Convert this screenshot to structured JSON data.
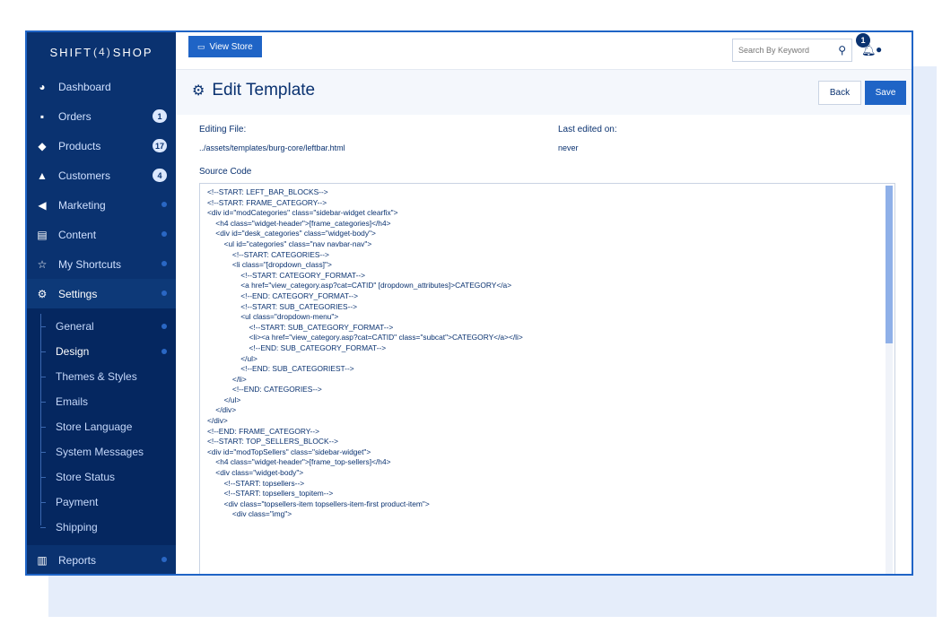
{
  "brand": {
    "left": "SHIFT",
    "mid": "4",
    "right": "SHOP"
  },
  "sidebar": {
    "items": [
      {
        "label": "Dashboard",
        "icon": "dashboard-icon",
        "glyph": "◕"
      },
      {
        "label": "Orders",
        "icon": "cart-icon",
        "glyph": "🛒",
        "badge": "1"
      },
      {
        "label": "Products",
        "icon": "tag-icon",
        "glyph": "◆",
        "badge": "17"
      },
      {
        "label": "Customers",
        "icon": "user-icon",
        "glyph": "▲",
        "badge": "4"
      },
      {
        "label": "Marketing",
        "icon": "megaphone-icon",
        "glyph": "◀"
      },
      {
        "label": "Content",
        "icon": "document-icon",
        "glyph": "▤"
      },
      {
        "label": "My Shortcuts",
        "icon": "star-icon",
        "glyph": "☆"
      },
      {
        "label": "Settings",
        "icon": "gears-icon",
        "glyph": "⚙"
      }
    ],
    "settings_sub": [
      "General",
      "Design",
      "Themes & Styles",
      "Emails",
      "Store Language",
      "System Messages",
      "Store Status",
      "Payment",
      "Shipping"
    ],
    "reports": {
      "label": "Reports",
      "icon": "bar-chart-icon",
      "glyph": "▥"
    }
  },
  "topbar": {
    "view_store": "View Store",
    "search_placeholder": "Search By Keyword",
    "notification_count": "1"
  },
  "page": {
    "title": "Edit Template",
    "back": "Back",
    "save": "Save",
    "editing_file_label": "Editing File:",
    "editing_file_value": "../assets/templates/burg-core/leftbar.html",
    "last_edited_label": "Last edited on:",
    "last_edited_value": "never",
    "source_code_label": "Source Code"
  },
  "code_lines": [
    "<!--START: LEFT_BAR_BLOCKS-->",
    "<!--START: FRAME_CATEGORY-->",
    "<div id=\"modCategories\" class=\"sidebar-widget clearfix\">",
    "    <h4 class=\"widget-header\">[frame_categories]</h4>",
    "    <div id=\"desk_categories\" class=\"widget-body\">",
    "        <ul id=\"categories\" class=\"nav navbar-nav\">",
    "            <!--START: CATEGORIES-->",
    "            <li class=\"[dropdown_class]\">",
    "                <!--START: CATEGORY_FORMAT-->",
    "                <a href=\"view_category.asp?cat=CATID\" [dropdown_attributes]>CATEGORY</a>",
    "                <!--END: CATEGORY_FORMAT-->",
    "                <!--START: SUB_CATEGORIES-->",
    "                <ul class=\"dropdown-menu\">",
    "                    <!--START: SUB_CATEGORY_FORMAT-->",
    "                    <li><a href=\"view_category.asp?cat=CATID\" class=\"subcat\">CATEGORY</a></li>",
    "                    <!--END: SUB_CATEGORY_FORMAT-->",
    "                </ul>",
    "                <!--END: SUB_CATEGORIEST-->",
    "            </li>",
    "            <!--END: CATEGORIES-->",
    "        </ul>",
    "    </div>",
    "</div>",
    "<!--END: FRAME_CATEGORY-->",
    "<!--START: TOP_SELLERS_BLOCK-->",
    "<div id=\"modTopSellers\" class=\"sidebar-widget\">",
    "    <h4 class=\"widget-header\">[frame_top-sellers]</h4>",
    "    <div class=\"widget-body\">",
    "        <!--START: topsellers-->",
    "        <!--START: topsellers_topitem-->",
    "        <div class=\"topsellers-item topsellers-item-first product-item\">",
    "            <div class=\"img\">"
  ],
  "colors": {
    "sidebar": "#0a3270",
    "accent": "#1f64c6"
  }
}
